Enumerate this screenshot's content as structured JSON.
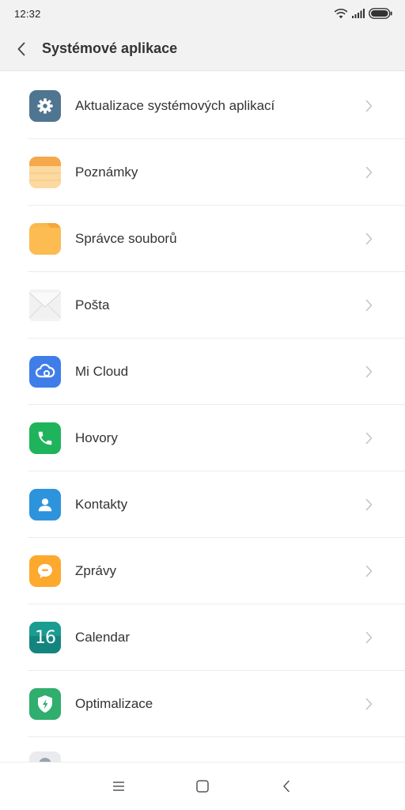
{
  "status_bar": {
    "time": "12:32",
    "icons": [
      "wifi-icon",
      "signal-icon",
      "battery-icon"
    ]
  },
  "header": {
    "title": "Systémové aplikace",
    "back_icon": "chevron-left-icon"
  },
  "items": [
    {
      "label": "Aktualizace systémových aplikací",
      "icon": "gear-icon",
      "color": "#4f7591"
    },
    {
      "label": "Poznámky",
      "icon": "notes-icon",
      "color": "#f5c377"
    },
    {
      "label": "Správce souborů",
      "icon": "folder-icon",
      "color": "#fbb850"
    },
    {
      "label": "Pošta",
      "icon": "envelope-icon",
      "color": "#eeeeee"
    },
    {
      "label": "Mi Cloud",
      "icon": "cloud-icon",
      "color": "#3f7ee8"
    },
    {
      "label": "Hovory",
      "icon": "phone-icon",
      "color": "#1fb45b"
    },
    {
      "label": "Kontakty",
      "icon": "contact-icon",
      "color": "#2d93dd"
    },
    {
      "label": "Zprávy",
      "icon": "message-icon",
      "color": "#fca92e"
    },
    {
      "label": "Calendar",
      "icon": "calendar-icon",
      "color": "#14857e",
      "icon_text": "16"
    },
    {
      "label": "Optimalizace",
      "icon": "shield-icon",
      "color": "#2fae6e"
    }
  ],
  "nav_bar": {
    "buttons": [
      "menu-icon",
      "home-icon",
      "back-icon"
    ]
  },
  "colors": {
    "background": "#ffffff",
    "header_background": "#f2f2f2",
    "text": "#333333",
    "divider": "#ececec",
    "chevron": "#c2c2c2"
  }
}
